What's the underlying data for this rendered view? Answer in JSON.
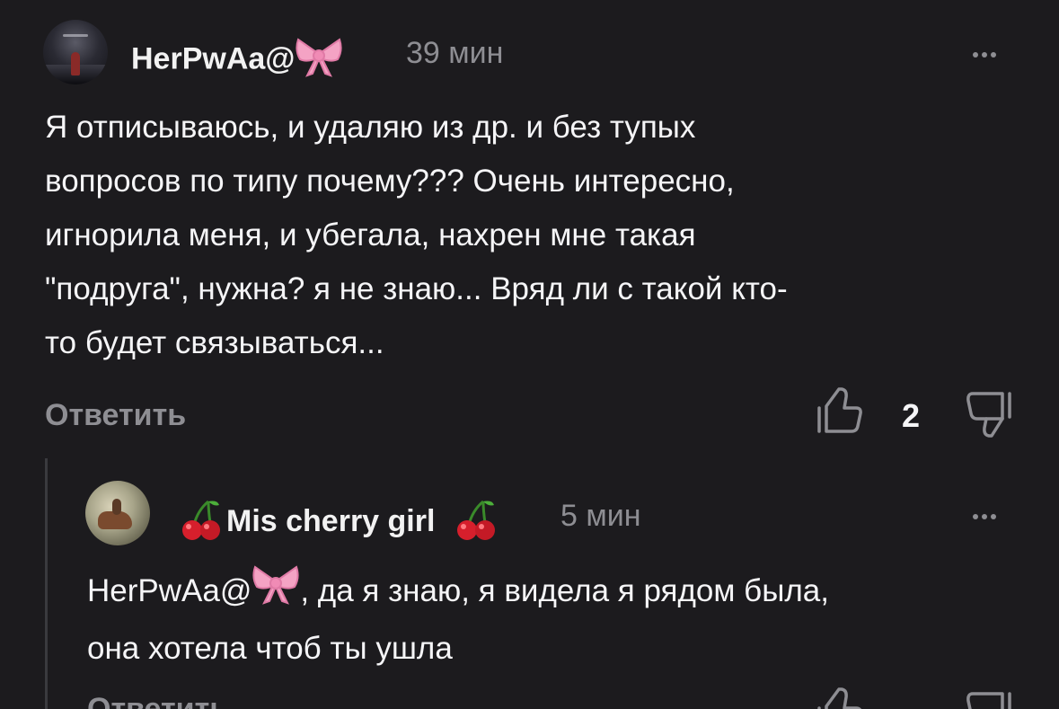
{
  "comment": {
    "username": "HerPwAa@",
    "username_emoji": "ribbon-bow",
    "time": "39 мин",
    "text_lines": [
      "Я отписываюсь, и удаляю из др. и без тупых",
      "вопросов по типу почему??? Очень интересно,",
      "игнорила меня, и убегала, нахрен мне такая",
      "\"подруга\", нужна? я не знаю... Вряд ли с такой кто-",
      "то будет связываться..."
    ],
    "reply_label": "Ответить",
    "likes": "2"
  },
  "reply": {
    "username": "Mis cherry girl",
    "username_emoji": "cherries",
    "time": "5 мин",
    "mention": "HerPwAa@",
    "text_line1_rest": ", да я знаю, я видела я рядом была,",
    "text_line2": "она хотела чтоб ты ушла",
    "reply_label": "Ответить"
  },
  "colors": {
    "background": "#1c1b1e",
    "text": "#f5f5f7",
    "muted": "#8e8e93",
    "bow": "#f4a3c4",
    "cherry": "#d61f2c"
  }
}
